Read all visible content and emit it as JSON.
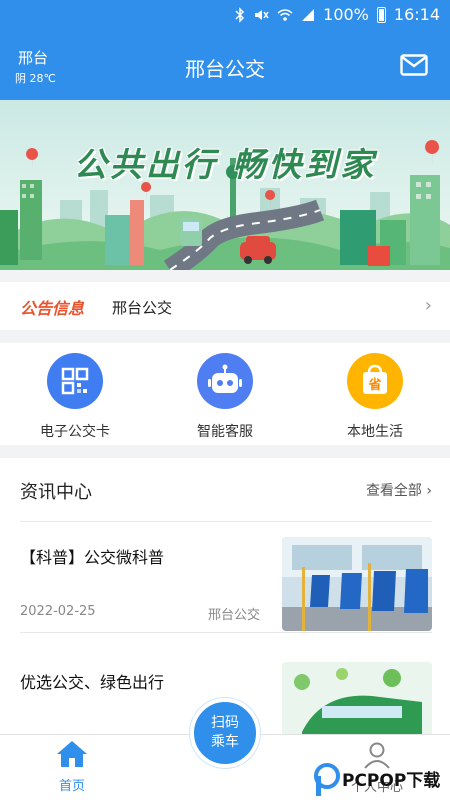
{
  "status_bar": {
    "battery": "100%",
    "time": "16:14",
    "icons": [
      "bluetooth-icon",
      "mute-icon",
      "wifi-icon",
      "signal-icon",
      "battery-icon"
    ]
  },
  "header": {
    "city": "邢台",
    "weather": "阴 28℃",
    "title": "邢台公交",
    "icon": "mail-icon"
  },
  "banner": {
    "slogan": "公共出行  畅快到家"
  },
  "notice": {
    "badge": "公告信息",
    "text": "邢台公交",
    "arrow": "›"
  },
  "services": [
    {
      "label": "电子公交卡",
      "icon": "qr-card-icon",
      "color": "#3f7df0"
    },
    {
      "label": "智能客服",
      "icon": "robot-icon",
      "color": "#4e7ef2"
    },
    {
      "label": "本地生活",
      "icon": "shopping-bag-icon",
      "color": "#ffb400"
    }
  ],
  "news": {
    "title": "资讯中心",
    "more": "查看全部",
    "items": [
      {
        "title": "【科普】公交微科普",
        "date": "2022-02-25",
        "source": "邢台公交"
      },
      {
        "title": "优选公交、绿色出行",
        "date": "",
        "source": ""
      }
    ]
  },
  "bottom_nav": {
    "home": "首页",
    "scan_line1": "扫码",
    "scan_line2": "乘车",
    "me": "个人中心"
  },
  "watermark": "PCPOP下载",
  "colors": {
    "primary": "#2f8fea",
    "notice_badge": "#e8542e",
    "slogan": "#2e8a52"
  }
}
